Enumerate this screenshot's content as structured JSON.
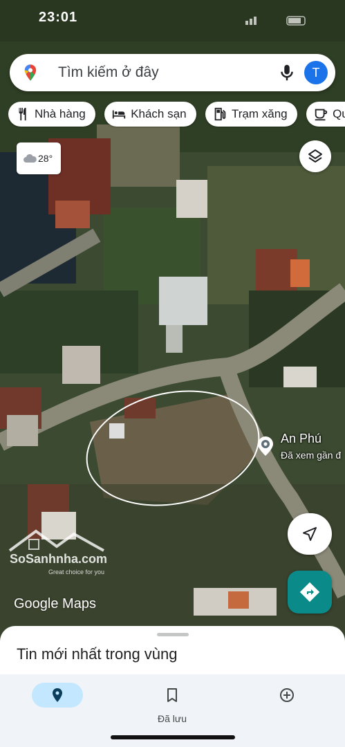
{
  "status_bar": {
    "time": "23:01"
  },
  "search": {
    "placeholder": "Tìm kiếm ở đây",
    "avatar_letter": "T"
  },
  "chips": [
    {
      "icon": "restaurant-icon",
      "label": "Nhà hàng"
    },
    {
      "icon": "hotel-icon",
      "label": "Khách sạn"
    },
    {
      "icon": "gas-station-icon",
      "label": "Trạm xăng"
    },
    {
      "icon": "cafe-icon",
      "label": "Quán"
    }
  ],
  "weather": {
    "temperature": "28°",
    "icon": "cloud-icon"
  },
  "place": {
    "name": "An Phú",
    "subtitle": "Đã xem gần đ"
  },
  "map_brand": "Google Maps",
  "watermark": {
    "brand": "SoSanhnha.com",
    "tagline": "Great choice for you"
  },
  "bottom_sheet": {
    "title": "Tin mới nhất trong vùng"
  },
  "nav": {
    "items": [
      {
        "icon": "explore-pin-icon",
        "label": "",
        "active": true
      },
      {
        "icon": "bookmark-icon",
        "label": "Đã lưu",
        "active": false
      },
      {
        "icon": "add-circle-icon",
        "label": "",
        "active": false
      }
    ]
  },
  "colors": {
    "accent_blue": "#1a73e8",
    "directions_teal": "#0b8a8a",
    "active_pill": "#c2e7ff",
    "nav_bg": "#f0f4f9"
  }
}
